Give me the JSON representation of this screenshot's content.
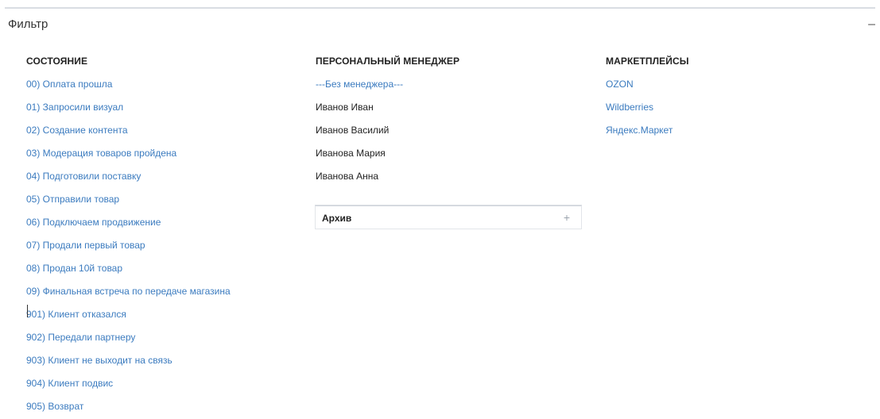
{
  "filter": {
    "title": "Фильтр",
    "collapse_symbol": "–"
  },
  "columns": {
    "status": {
      "header": "СОСТОЯНИЕ",
      "items": [
        "00) Оплата прошла",
        "01) Запросили визуал",
        "02) Создание контента",
        "03) Модерация товаров пройдена",
        "04) Подготовили поставку",
        "05) Отправили товар",
        "06) Подключаем продвижение",
        "07) Продали первый товар",
        "08) Продан 10й товар",
        "09) Финальная встреча по передаче магазина",
        "901) Клиент отказался",
        "902) Передали партнеру",
        "903) Клиент не выходит на связь",
        "904) Клиент подвис",
        "905) Возврат"
      ]
    },
    "manager": {
      "header": "ПЕРСОНАЛЬНЫЙ МЕНЕДЖЕР",
      "items": [
        "---Без менеджера---",
        "Иванов Иван",
        "Иванов Василий",
        "Иванова Мария",
        "Иванова Анна"
      ]
    },
    "marketplaces": {
      "header": "МАРКЕТПЛЕЙСЫ",
      "items": [
        "OZON",
        "Wildberries",
        "Яндекс.Маркет"
      ]
    }
  },
  "archive": {
    "label": "Архив",
    "expand_symbol": "+"
  },
  "colors": {
    "link": "#3b7bbf",
    "text": "#222222",
    "border": "#d9dde3"
  }
}
